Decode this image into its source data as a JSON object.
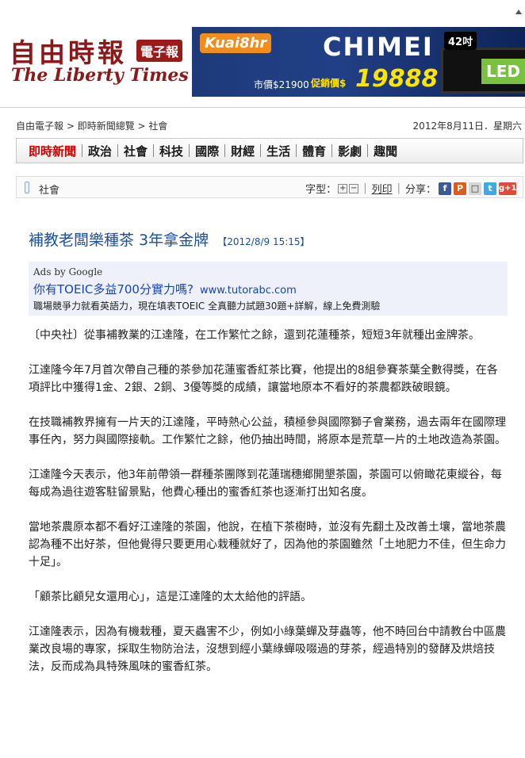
{
  "header": {
    "logo_cn": "自由時報",
    "logo_badge": "電子報",
    "logo_en": "The Liberty Times"
  },
  "banner": {
    "kuai": "Kuai8hr",
    "brand": "CHIMEI",
    "size": "42吋",
    "led": "LED",
    "price_label": "市價$21900",
    "promo_label": "促銷價$",
    "price": "19888"
  },
  "breadcrumb": [
    "自由電子報",
    "即時新聞總覽",
    "社會"
  ],
  "breadcrumb_sep": " > ",
  "date": "2012年8月11日．星期六",
  "nav": {
    "items": [
      "即時新聞",
      "政治",
      "社會",
      "科技",
      "國際",
      "財經",
      "生活",
      "體育",
      "影劇",
      "趣聞"
    ]
  },
  "section": {
    "label": "社會",
    "font_label": "字型：",
    "print": "列印",
    "share": "分享："
  },
  "article": {
    "title": "補教老闆樂種茶 3年拿金牌",
    "time": "【2012/8/9 15:15】",
    "paragraphs": [
      "〔中央社〕從事補教業的江達隆，在工作繁忙之餘，還到花蓮種茶，短短3年就種出金牌茶。",
      "江達隆今年7月首次帶自己種的茶參加花蓮蜜香紅茶比賽，他提出的8組參賽茶葉全數得獎，在各項評比中獲得1金、2銀、2銅、3優等獎的成績，讓當地原本不看好的茶農都跌破眼鏡。",
      "在技職補教界擁有一片天的江達隆，平時熱心公益，積極參與國際獅子會業務，過去兩年在國際理事任內，努力與國際接軌。工作繁忙之餘，他仍抽出時間，將原本是荒草一片的土地改造為茶園。",
      "江達隆今天表示，他3年前帶領一群種茶團隊到花蓮瑞穗鄉開墾茶園，茶園可以俯瞰花東縱谷，每每成為過往遊客駐留景點，他費心種出的蜜香紅茶也逐漸打出知名度。",
      "當地茶農原本都不看好江達隆的茶園，他說，在植下茶樹時，並沒有先翻土及改善土壤，當地茶農認為種不出好茶，但他覺得只要更用心栽種就好了，因為他的茶園雖然「土地肥力不佳，但生命力十足」。",
      "「顧茶比顧兒女還用心」，這是江達隆的太太給他的評語。",
      "江達隆表示，因為有機栽種，夏天蟲害不少，例如小綠葉蟬及芽蟲等，他不時回台中請教台中區農業改良場的專家，採取生物防治法，沒想到經小葉綠蟬吸啜過的芽茶，經過特別的發酵及烘焙技法，反而成為具特殊風味的蜜香紅茶。"
    ]
  },
  "ads": {
    "by": "Ads by Google",
    "title": "你有TOEIC多益700分實力嗎?",
    "url": "www.tutorabc.com",
    "desc": "職場競爭力就看英語力，現在填表TOEIC 全真聽力試題30題+詳解，線上免費測驗"
  }
}
